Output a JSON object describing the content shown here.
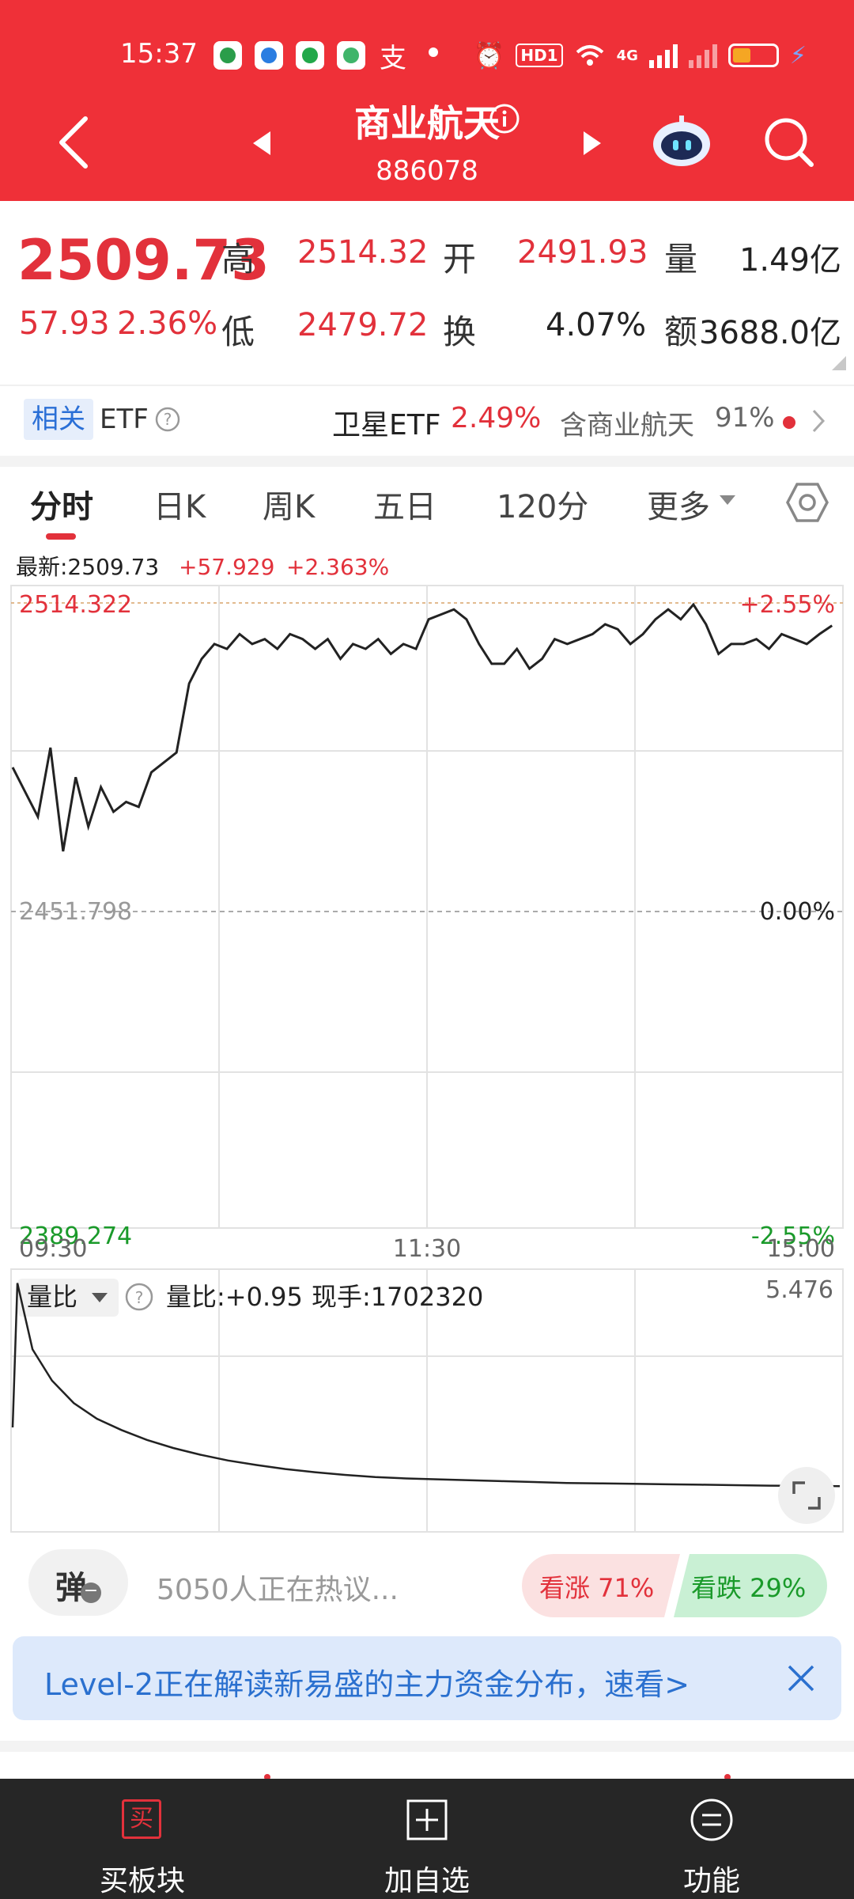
{
  "status_bar": {
    "time": "15:37",
    "network": "4G",
    "hd": "HD1"
  },
  "nav": {
    "title": "商业航天",
    "code": "886078"
  },
  "quote": {
    "price": "2509.73",
    "change": "57.93",
    "change_pct": "2.36%",
    "high_label": "高",
    "high": "2514.32",
    "open_label": "开",
    "open": "2491.93",
    "volume_label": "量",
    "volume": "1.49亿",
    "low_label": "低",
    "low": "2479.72",
    "turnover_label": "换",
    "turnover": "4.07%",
    "amount_label": "额",
    "amount": "3688.0亿"
  },
  "etf_row": {
    "tag": "相关",
    "etf": "ETF",
    "fund_name": "卫星ETF",
    "fund_pct": "2.49%",
    "contains": "含商业航天",
    "contains_pct": "91%"
  },
  "tabs": [
    "分时",
    "日K",
    "周K",
    "五日",
    "120分",
    "更多"
  ],
  "chart_info": {
    "latest": "最新:2509.73",
    "chg": "+57.929",
    "chg_pct": "+2.363%"
  },
  "chart_data": {
    "type": "line",
    "ylim": [
      2389.274,
      2514.322
    ],
    "y_ticks_left": [
      "2514.322",
      "2451.798",
      "2389.274"
    ],
    "y_ticks_right": [
      "+2.55%",
      "0.00%",
      "-2.55%"
    ],
    "x_ticks": [
      "09:30",
      "11:30",
      "15:00"
    ],
    "baseline": 2451.798,
    "series": [
      {
        "values": [
          2481,
          2476,
          2471,
          2485,
          2464,
          2479,
          2469,
          2477,
          2472,
          2474,
          2473,
          2480,
          2482,
          2484,
          2498,
          2503,
          2506,
          2505,
          2508,
          2506,
          2507,
          2505,
          2508,
          2507,
          2505,
          2507,
          2503,
          2506,
          2505,
          2507,
          2504,
          2506,
          2505,
          2511,
          2512,
          2513,
          2511,
          2506,
          2502,
          2502,
          2505,
          2501,
          2503,
          2507,
          2506,
          2507,
          2508,
          2510,
          2509,
          2506,
          2508,
          2511,
          2513,
          2511,
          2514,
          2510,
          2504,
          2506,
          2506,
          2507,
          2505,
          2508,
          2507,
          2506,
          2508,
          2509.73
        ]
      }
    ]
  },
  "volume_panel": {
    "selector": "量比",
    "ratio": "量比:+0.95",
    "current_hand": "现手:1702320",
    "max": "5.476",
    "values": [
      5.476,
      4.0,
      3.3,
      2.8,
      2.45,
      2.2,
      1.98,
      1.8,
      1.65,
      1.52,
      1.42,
      1.33,
      1.26,
      1.2,
      1.15,
      1.12,
      1.1,
      1.08,
      1.06,
      1.04,
      1.02,
      1.01,
      1.0,
      0.99,
      0.98,
      0.97,
      0.96,
      0.955,
      0.95
    ]
  },
  "comment_bar": {
    "bullet_label": "弹",
    "discuss": "5050人正在热议...",
    "up": "看涨 71%",
    "down": "看跌 29%"
  },
  "banner": {
    "text": "Level-2正在解读新易盛的主力资金分布，速看>"
  },
  "bottom_nav": {
    "buy": "买板块",
    "buy_icon": "买",
    "add": "加自选",
    "func": "功能"
  },
  "colors": {
    "header_red": "#ef3038",
    "up_red": "#e2313b",
    "down_green": "#1a9a2a"
  }
}
